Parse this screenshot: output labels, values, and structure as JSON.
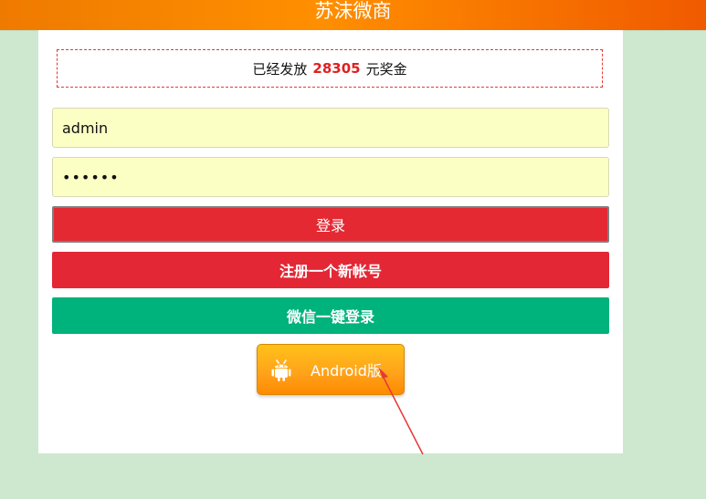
{
  "header": {
    "title": "苏沫微商"
  },
  "bonus": {
    "prefix": "已经发放",
    "amount": "28305",
    "suffix": "元奖金"
  },
  "login_form": {
    "username_value": "admin",
    "password_value": "••••••"
  },
  "buttons": {
    "login": "登录",
    "register": "注册一个新帐号",
    "wechat_login": "微信一键登录",
    "android": "Android版"
  },
  "icons": {
    "android": "android-icon"
  },
  "colors": {
    "header_orange": "#ff8f00",
    "background_green": "#cde8cf",
    "bonus_red": "#e11f1f",
    "login_red": "#e42933",
    "wechat_green": "#00b27b",
    "android_orange": "#ffa11a",
    "annotation_arrow": "#e53935"
  }
}
